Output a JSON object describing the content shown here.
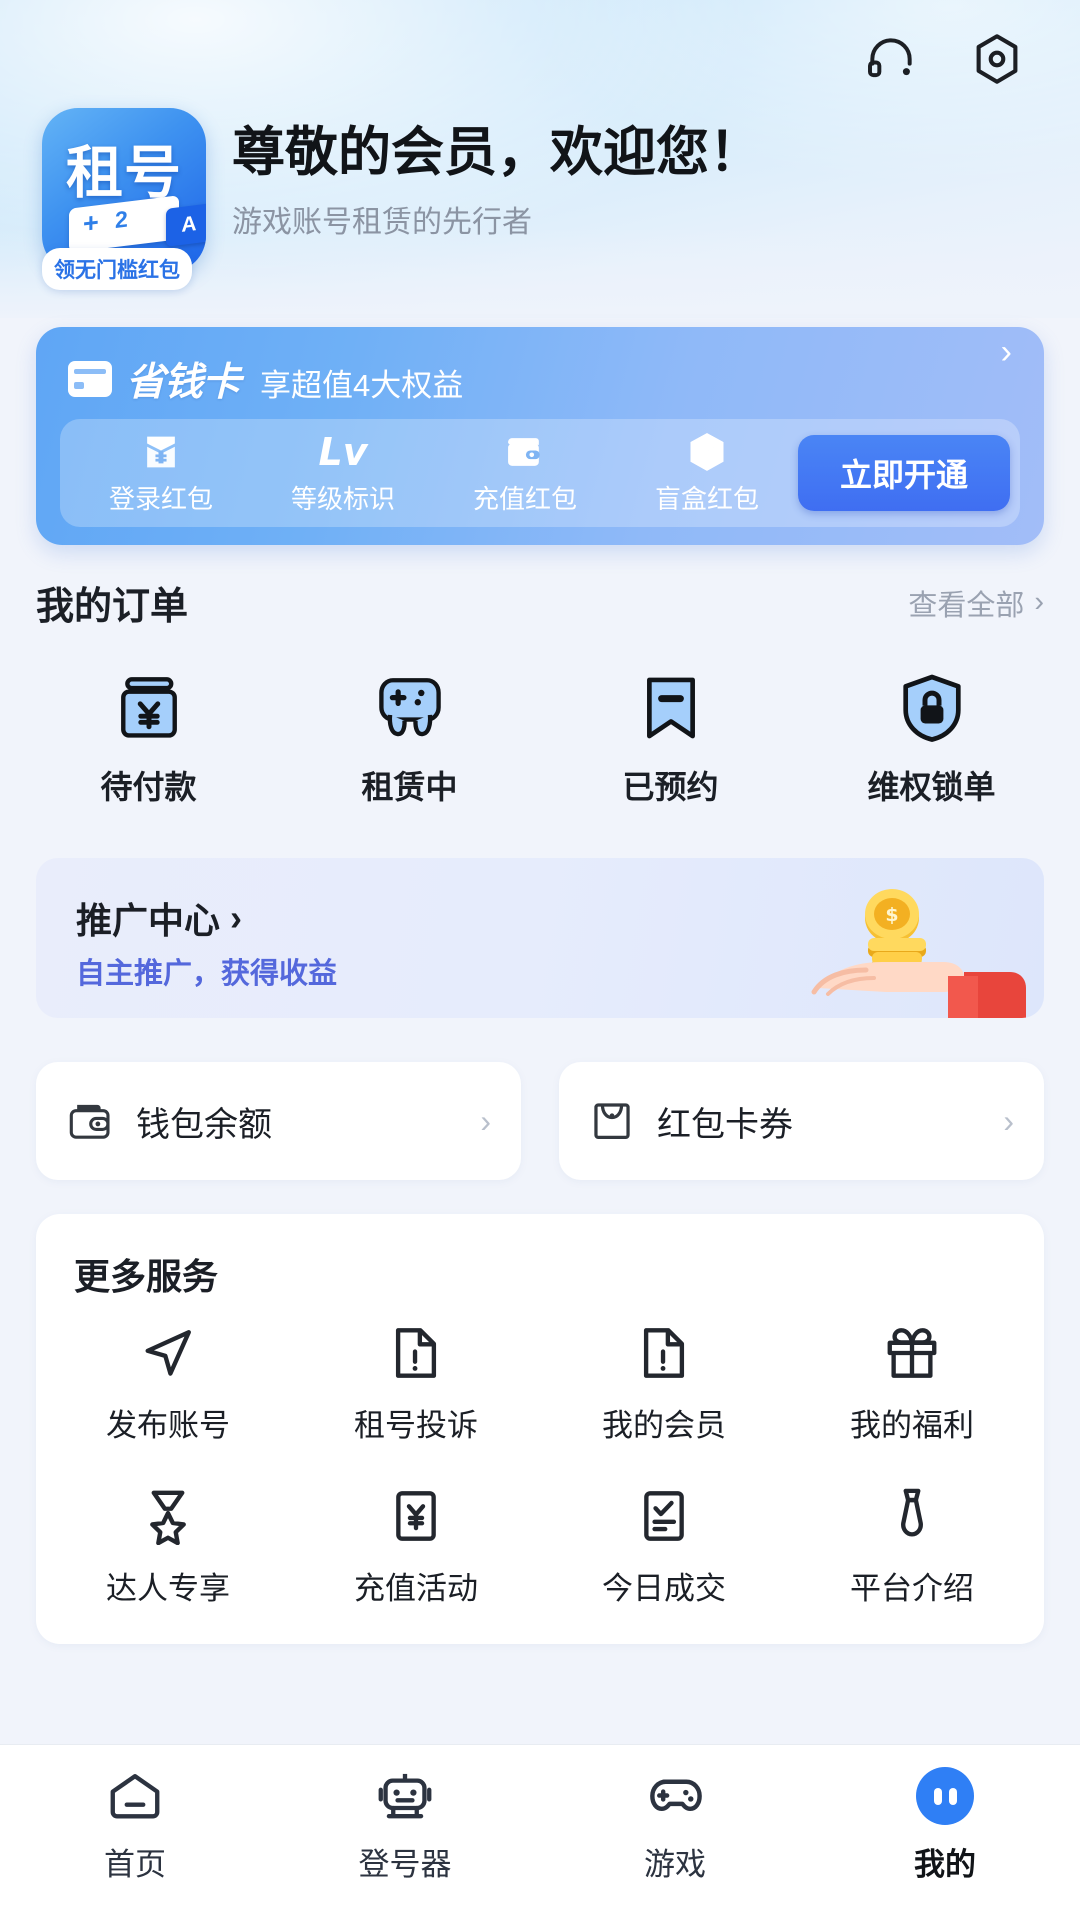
{
  "header": {
    "greeting": "尊敬的会员，欢迎您！",
    "subtitle": "游戏账号租赁的先行者",
    "avatar_text": "租号",
    "avatar_tag": "A",
    "avatar_badge": "领无门槛红包",
    "icons": {
      "support": "headset-icon",
      "settings": "settings-icon"
    }
  },
  "save_card": {
    "brand": "省钱卡",
    "desc": "享超值4大权益",
    "arrow": "›",
    "open_label": "立即开通",
    "benefits": [
      {
        "label": "登录红包",
        "icon": "red-packet-icon"
      },
      {
        "label": "等级标识",
        "icon": "level-icon",
        "glyph": "Lv"
      },
      {
        "label": "充值红包",
        "icon": "wallet-icon"
      },
      {
        "label": "盲盒红包",
        "icon": "blind-box-icon"
      }
    ]
  },
  "orders": {
    "title": "我的订单",
    "see_all": "查看全部",
    "see_all_arrow": "›",
    "items": [
      {
        "label": "待付款",
        "icon": "payment-pending-icon"
      },
      {
        "label": "租赁中",
        "icon": "gamepad-renting-icon"
      },
      {
        "label": "已预约",
        "icon": "bookmark-reserved-icon"
      },
      {
        "label": "维权锁单",
        "icon": "shield-lock-icon"
      }
    ]
  },
  "promote": {
    "title": "推广中心",
    "title_arrow": "›",
    "subtitle": "自主推广，获得收益",
    "art": "coins-in-hand-illustration"
  },
  "wallet_row": [
    {
      "label": "钱包余额",
      "icon": "wallet-icon",
      "arrow": "›"
    },
    {
      "label": "红包卡券",
      "icon": "envelope-icon",
      "arrow": "›"
    }
  ],
  "more_services": {
    "title": "更多服务",
    "items": [
      {
        "label": "发布账号",
        "icon": "send-plane-icon"
      },
      {
        "label": "租号投诉",
        "icon": "document-alert-icon"
      },
      {
        "label": "我的会员",
        "icon": "document-alert-icon"
      },
      {
        "label": "我的福利",
        "icon": "gift-icon"
      },
      {
        "label": "达人专享",
        "icon": "medal-star-icon"
      },
      {
        "label": "充值活动",
        "icon": "yen-document-icon"
      },
      {
        "label": "今日成交",
        "icon": "checklist-icon"
      },
      {
        "label": "平台介绍",
        "icon": "tie-icon"
      }
    ]
  },
  "navbar": {
    "items": [
      {
        "label": "首页",
        "icon": "home-icon",
        "active": false
      },
      {
        "label": "登号器",
        "icon": "robot-icon",
        "active": false
      },
      {
        "label": "游戏",
        "icon": "gamepad-icon",
        "active": false
      },
      {
        "label": "我的",
        "icon": "profile-icon",
        "active": true
      }
    ]
  },
  "colors": {
    "accent": "#2f7ff5",
    "card_blue": "#6fb0f6",
    "icon_fill": "#a5cffb",
    "text_primary": "#1b1f26",
    "text_muted": "#9aa2b1",
    "promote_link": "#5468dc"
  }
}
